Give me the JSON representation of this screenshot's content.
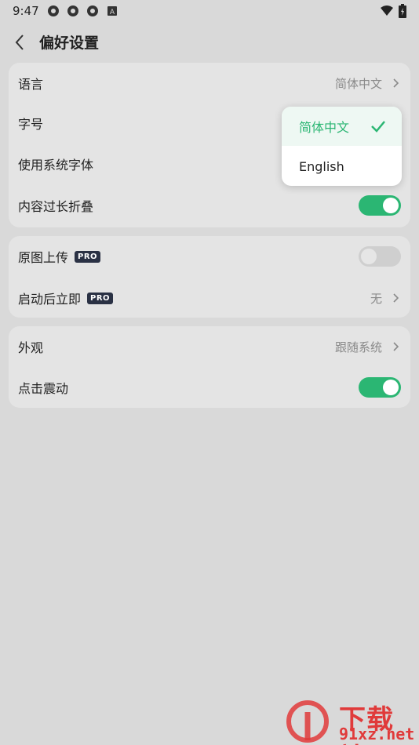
{
  "status_bar": {
    "time": "9:47",
    "icons": [
      "settings-gear-icon",
      "settings-gear-icon",
      "settings-gear-icon",
      "a-box-icon"
    ],
    "right_icons": [
      "wifi-icon",
      "battery-icon"
    ]
  },
  "header": {
    "title": "偏好设置"
  },
  "sections": [
    {
      "rows": [
        {
          "label": "语言",
          "value": "简体中文",
          "control": "chevron"
        },
        {
          "label": "字号",
          "control": "none"
        },
        {
          "label": "使用系统字体",
          "control": "none"
        },
        {
          "label": "内容过长折叠",
          "control": "toggle",
          "on": true
        }
      ]
    },
    {
      "rows": [
        {
          "label": "原图上传",
          "badge": "PRO",
          "control": "toggle",
          "on": false
        },
        {
          "label": "启动后立即",
          "badge": "PRO",
          "value": "无",
          "control": "chevron"
        }
      ]
    },
    {
      "rows": [
        {
          "label": "外观",
          "value": "跟随系统",
          "control": "chevron"
        },
        {
          "label": "点击震动",
          "control": "toggle",
          "on": true
        }
      ]
    }
  ],
  "language_popup": {
    "options": [
      {
        "label": "简体中文",
        "selected": true
      },
      {
        "label": "English",
        "selected": false
      }
    ]
  },
  "watermark": {
    "top_text": "下载站",
    "bottom_text": "91xz.net"
  },
  "colors": {
    "accent": "#2bb673",
    "background": "#d9d9d9",
    "card": "#e4e4e4",
    "badge": "#2a3144",
    "watermark": "#e03a3a"
  }
}
